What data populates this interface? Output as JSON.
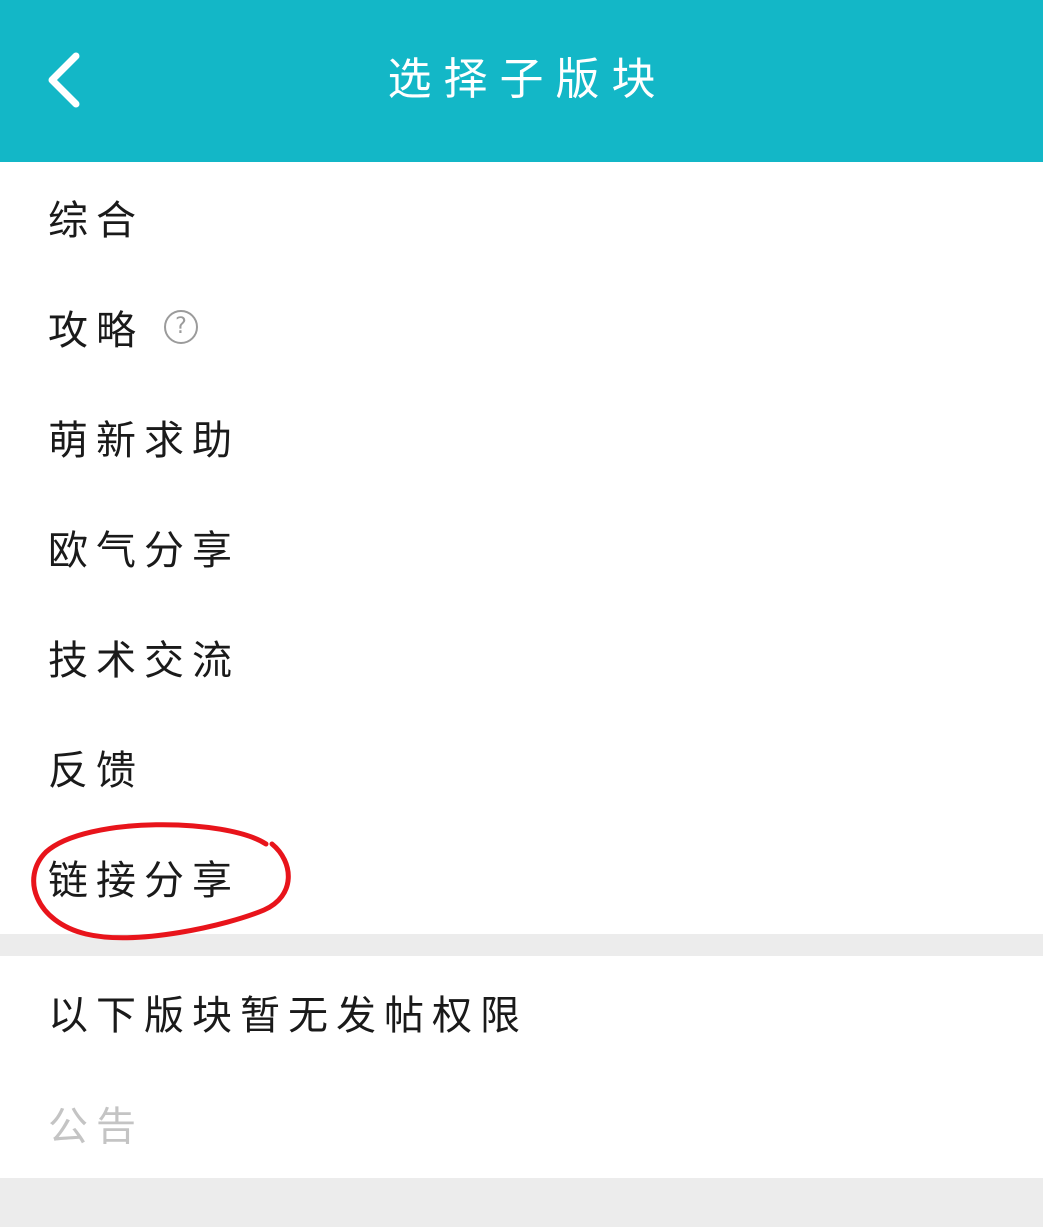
{
  "header": {
    "title": "选择子版块",
    "back_icon": "chevron-left-icon",
    "background_color": "#13b7c7"
  },
  "boards": [
    {
      "label": "综合"
    },
    {
      "label": "攻略",
      "help_icon": "question-circle-icon",
      "help_symbol": "?"
    },
    {
      "label": "萌新求助"
    },
    {
      "label": "欧气分享"
    },
    {
      "label": "技术交流"
    },
    {
      "label": "反馈"
    },
    {
      "label": "链接分享",
      "highlighted": true,
      "highlight_color": "#e8141b"
    }
  ],
  "restricted_section": {
    "title": "以下版块暂无发帖权限",
    "items": [
      {
        "label": "公告",
        "disabled": true
      }
    ]
  }
}
